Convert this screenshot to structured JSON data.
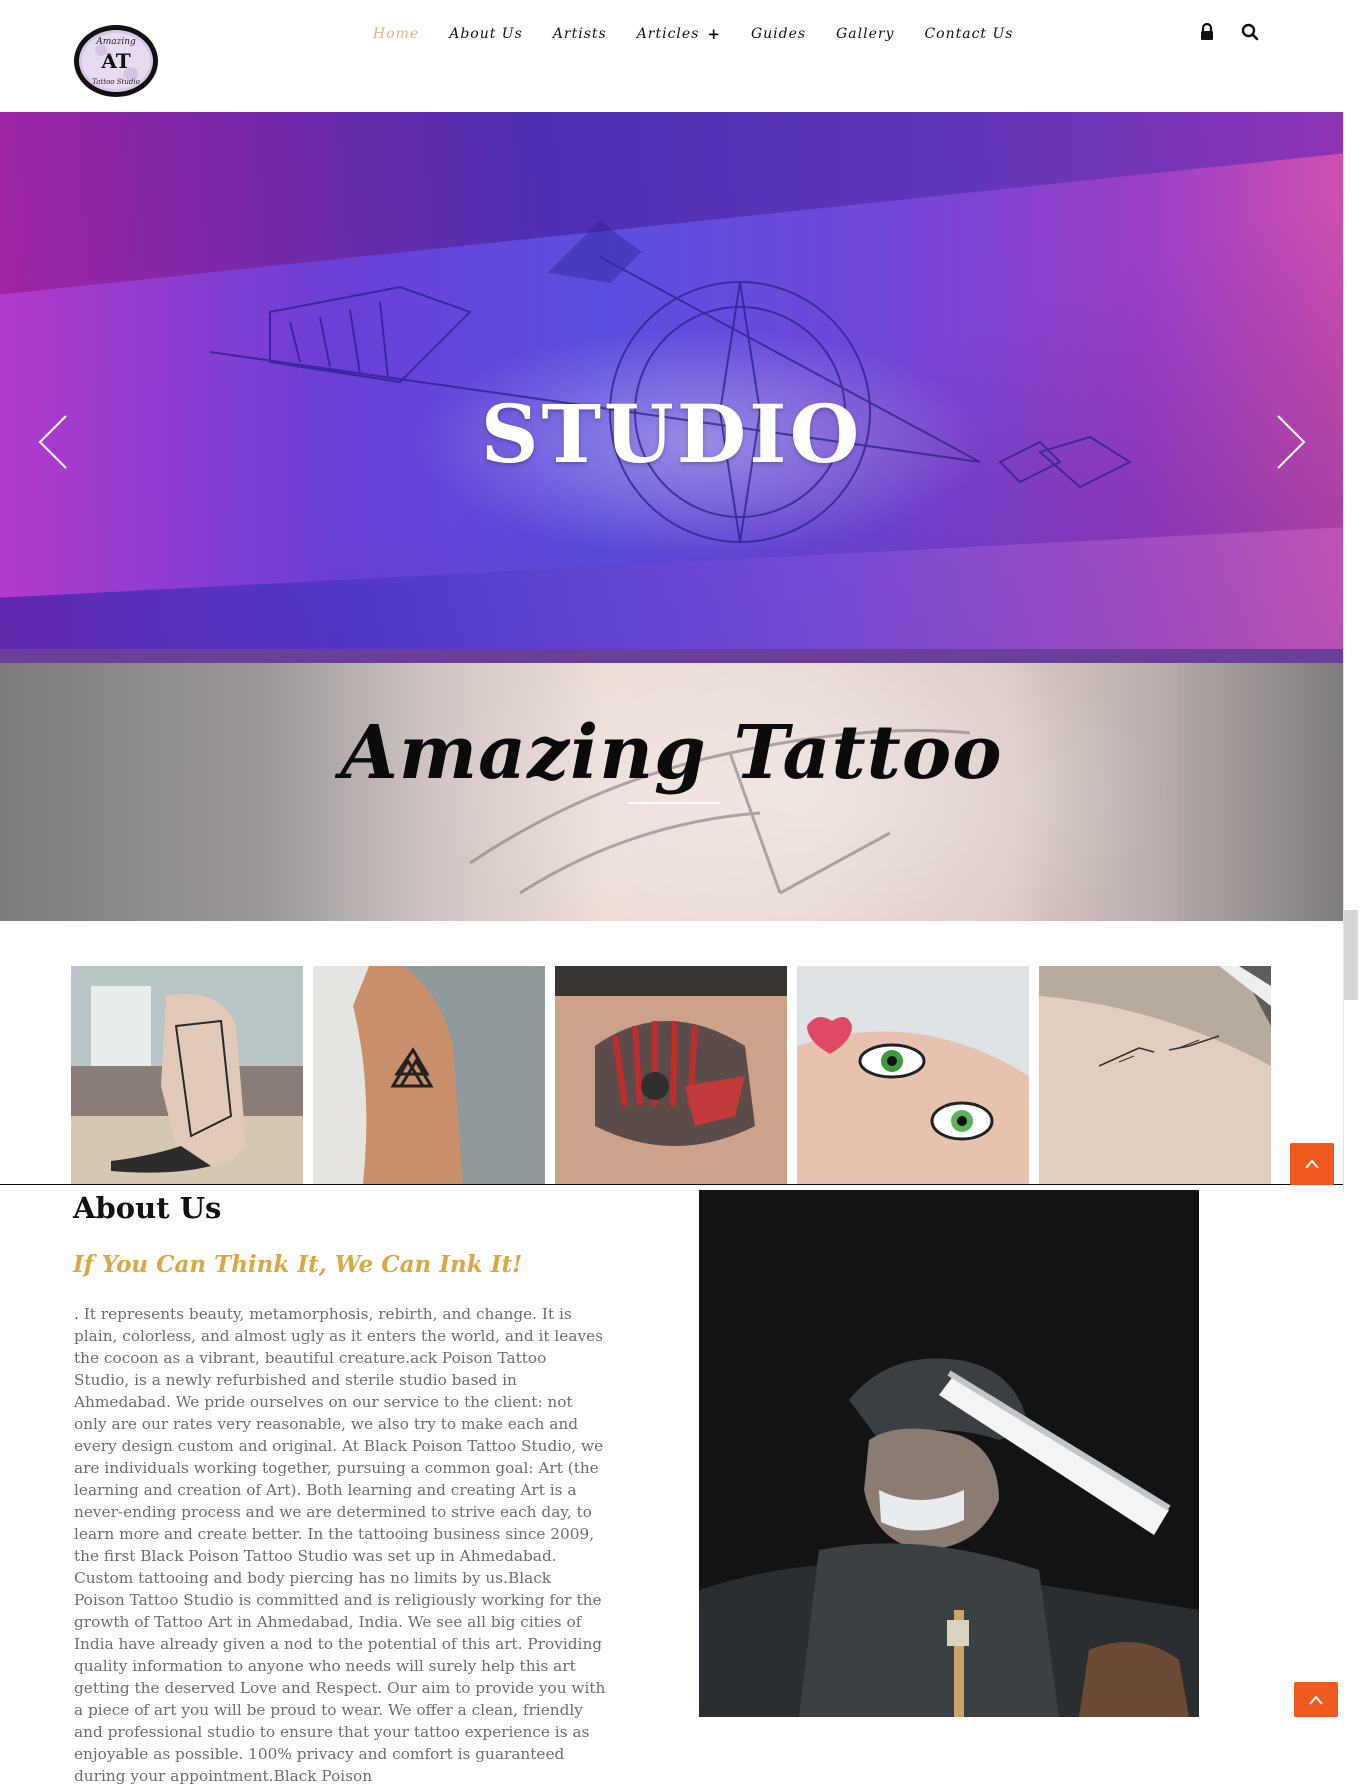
{
  "header": {
    "logo": {
      "text_top": "Amazing",
      "monogram": "AT",
      "text_bottom": "Tattoo Studio"
    },
    "nav": [
      {
        "label": "Home",
        "active": true
      },
      {
        "label": "About Us"
      },
      {
        "label": "Artists"
      },
      {
        "label": "Articles",
        "has_submenu": true,
        "submenu_icon": "+"
      },
      {
        "label": "Guides"
      },
      {
        "label": "Gallery"
      },
      {
        "label": "Contact Us"
      }
    ],
    "icons": [
      "lock-icon",
      "search-icon"
    ]
  },
  "hero": {
    "title": "STUDIO",
    "prev_icon": "chevron-left-icon",
    "next_icon": "chevron-right-icon"
  },
  "banner": {
    "title": "Amazing Tattoo"
  },
  "gallery": {
    "items": [
      {
        "name": "sketch-leg-tattoo"
      },
      {
        "name": "triangle-forearm-tattoo"
      },
      {
        "name": "wolf-headdress-back-tattoo"
      },
      {
        "name": "eyes-heart-arm-tattoo"
      },
      {
        "name": "hands-arm-tattoo"
      }
    ]
  },
  "about": {
    "heading": "About Us",
    "subheading": "If You Can Think It, We Can Ink It!",
    "body": ". It represents beauty, metamorphosis, rebirth, and change. It is plain, colorless, and almost ugly as it enters the world, and it leaves the cocoon as a vibrant, beautiful creature.ack Poison Tattoo Studio, is a newly refurbished and sterile studio based in Ahmedabad. We pride ourselves on our service to the client: not only are our rates very reasonable, we also try to make each and every design custom and original. At Black Poison Tattoo Studio, we are individuals working together, pursuing a common goal: Art (the learning and creation of Art). Both learning and creating Art is a never-ending process and we are determined to strive each day, to learn more and create better. In the tattooing business since 2009, the first Black Poison Tattoo Studio was set up in Ahmedabad. Custom tattooing and body piercing has no limits by us.Black Poison Tattoo Studio is committed and is religiously working for the growth of Tattoo Art in Ahmedabad, India. We see all big cities of India have already given a nod to the potential of this art. Providing quality information to anyone who needs will surely help this art getting the deserved Love and Respect. Our aim to provide you with a piece of art you will be proud to wear. We offer a clean, friendly and professional studio to ensure that your tattoo experience is as enjoyable as possible. 100% privacy and comfort is guaranteed during your appointment.Black Poison"
  },
  "controls": {
    "back_to_top_icon": "chevron-up-icon"
  },
  "colors": {
    "nav_active": "#d8b48a",
    "subheading": "#d9a844",
    "back_to_top": "#f05a1e",
    "body_text": "#6c6c6c"
  }
}
